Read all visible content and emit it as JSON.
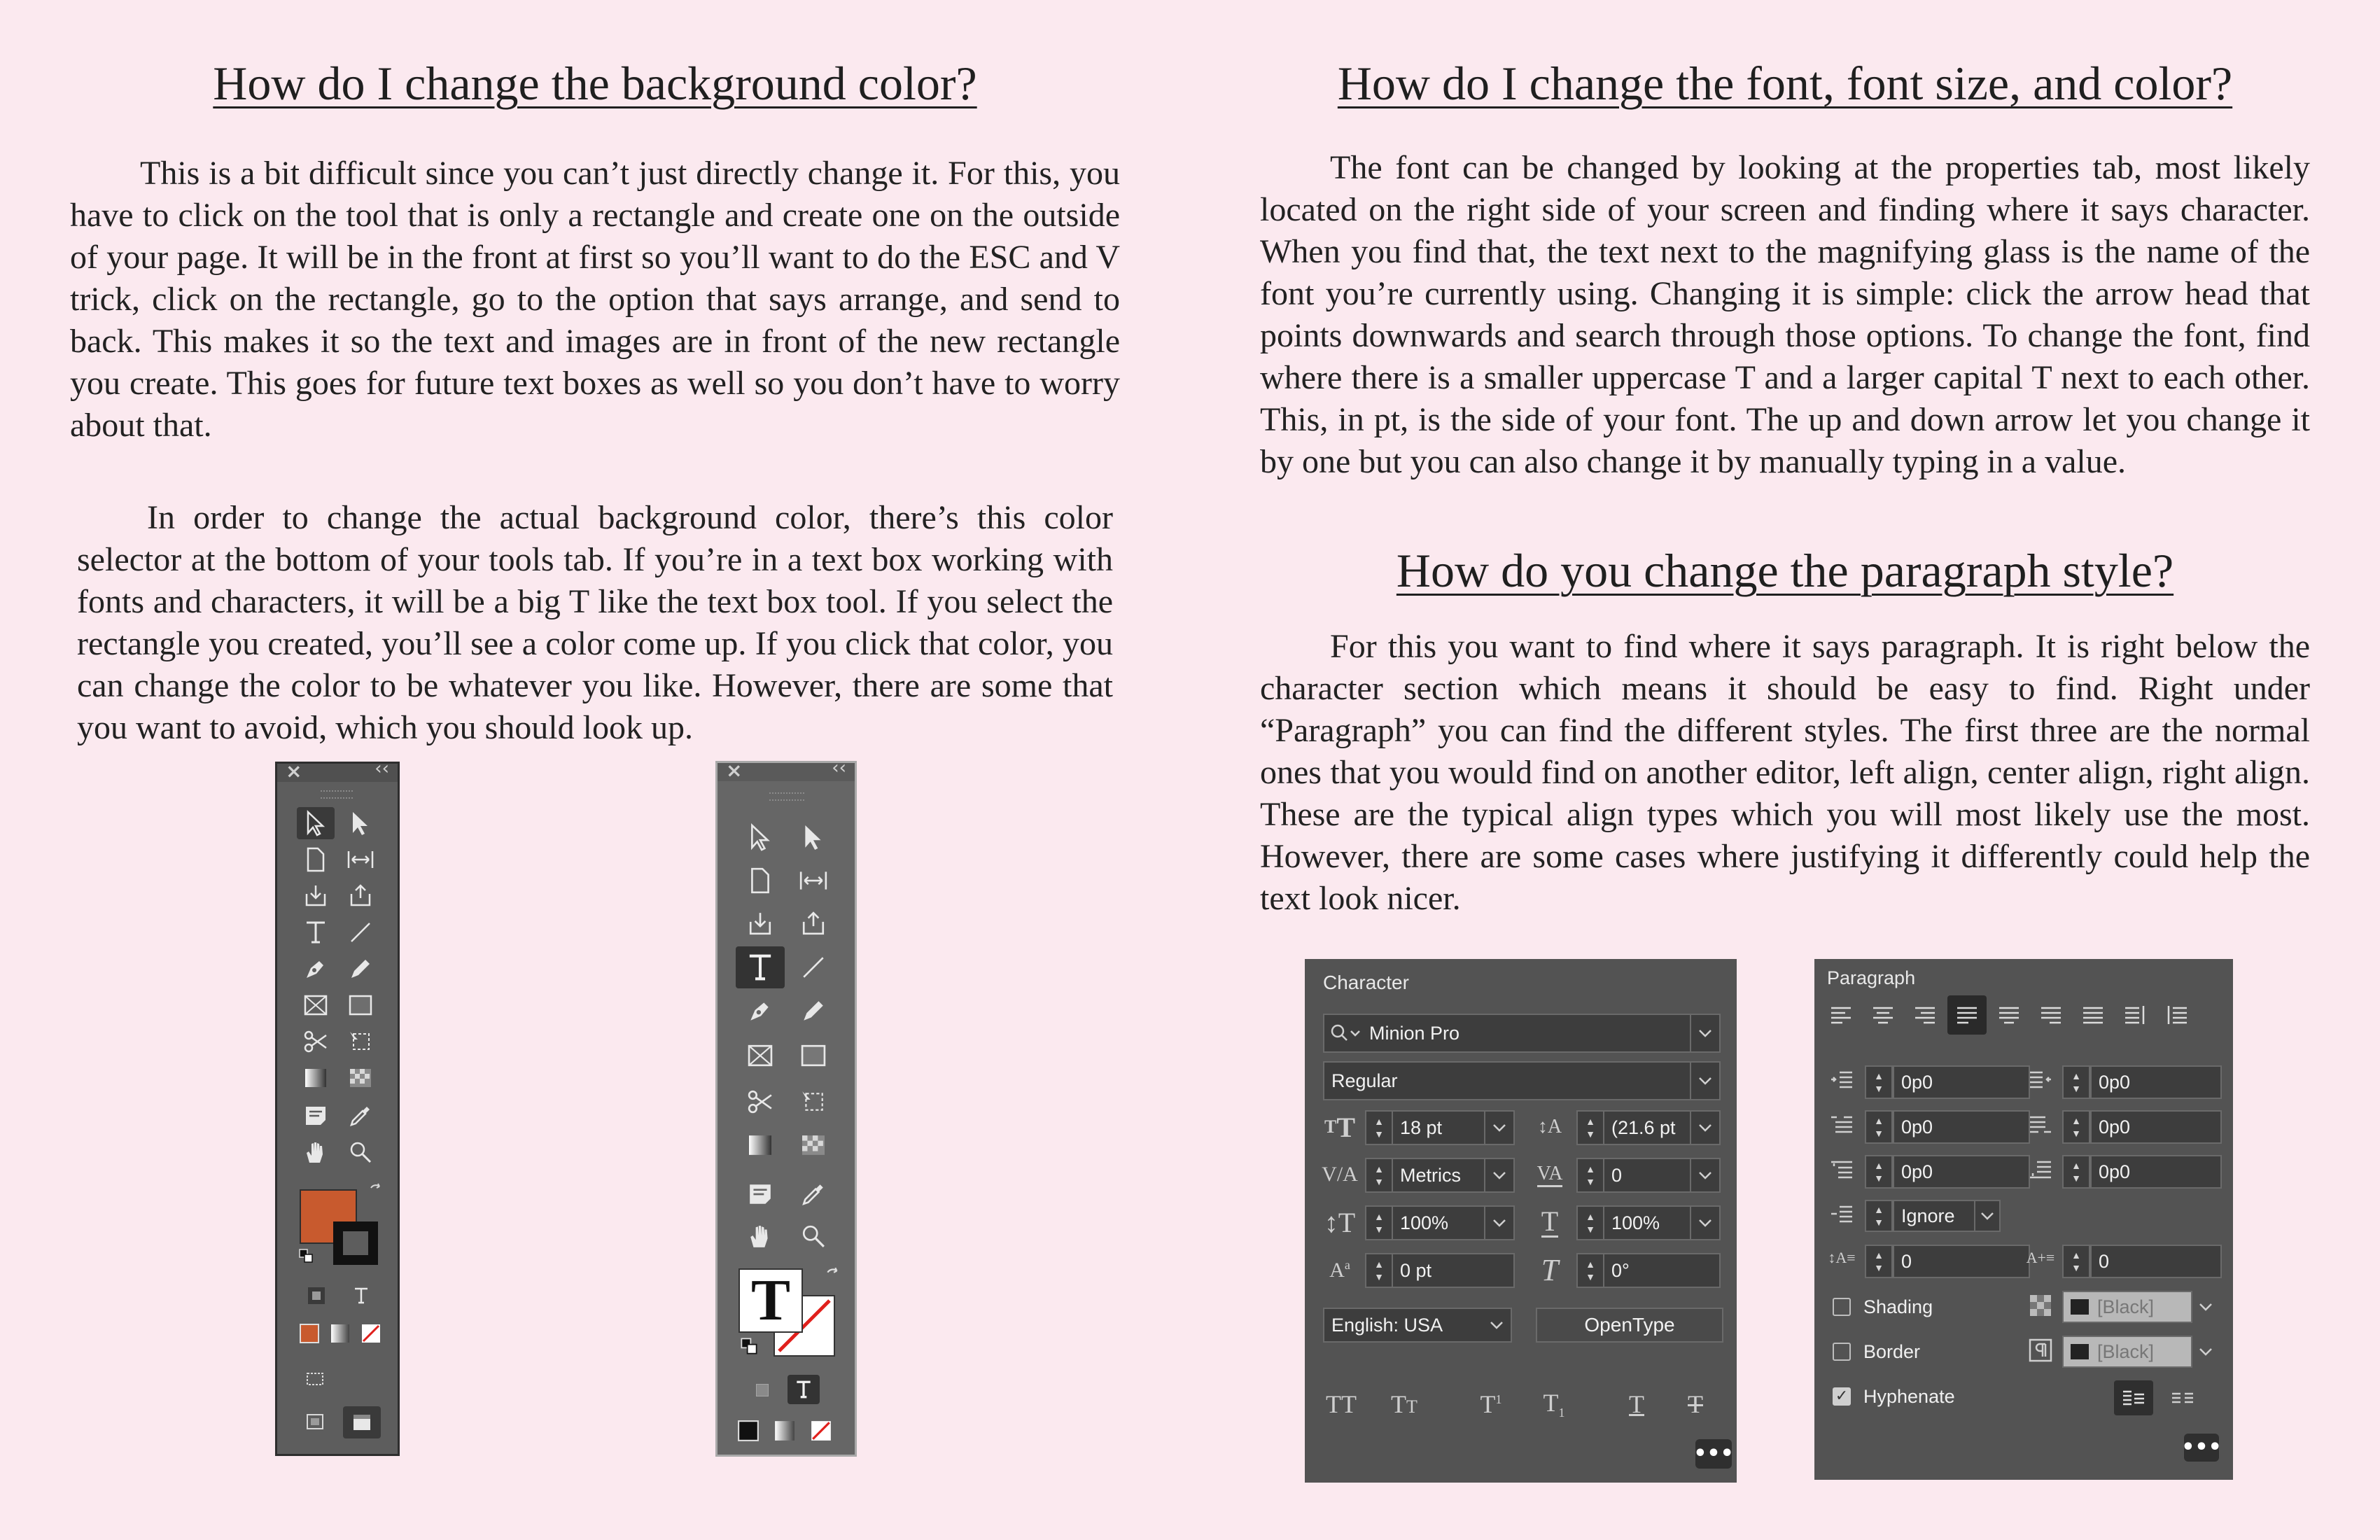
{
  "left": {
    "heading": "How do I change the background color?",
    "para1": "This is a bit difficult since you can’t just directly change it. For this, you have to click on the tool that is only a rectangle and create one on the outside of your page. It will be in the front at first so you’ll want to do the ESC and V trick, click on the rectangle, go to the option that says arrange, and send to back. This makes it so the text and images are in front of the new rectangle you create. This goes for future text boxes as well so you don’t have to worry about that.",
    "para2": "In order to change the actual background color, there’s this color selector at the bottom of your tools tab. If you’re in a text box working with fonts and characters, it will be a big T like the text box tool. If you select the rectangle you created, you’ll see a color come up. If you click that color, you can change the color to be whatever you like. However, there are some that you want to avoid, which you should look up."
  },
  "right": {
    "heading1": "How do I change the font, font size, and color?",
    "para1": "The font can be changed by looking at the properties tab, most likely located on the right side of your screen and finding where it says character. When you find that, the text next to the magnifying glass is the name of the font you’re currently using. Changing it is simple: click the arrow head that points downwards and search through those options. To change the font, find where there is a smaller uppercase T and a larger capital T next to each other. This, in pt, is the side of your font. The up and down arrow let you change it by one but you can also change it by manually typing in a value.",
    "heading2": "How do you change the paragraph style?",
    "para2": "For this you want to find where it says paragraph. It is right below the character section which means it should be easy to find. Right under “Paragraph” you can find the different styles. The first three are the normal ones that you would find on another editor, left align, center align, right align. These are the typical align types which you will most likely use the most. However, there are some cases where justifying it differently could help the text look nicer."
  },
  "toolbox": {
    "close_glyph": "×",
    "collapse_glyph": "‹‹",
    "fill_color": "#c85a2e",
    "type_glyph": "T"
  },
  "character_panel": {
    "title": "Character",
    "font_family": "Minion Pro",
    "font_style": "Regular",
    "font_size": "18 pt",
    "leading": "(21.6 pt",
    "kerning": "Metrics",
    "tracking": "0",
    "vertical_scale": "100%",
    "horizontal_scale": "100%",
    "baseline_shift": "0 pt",
    "skew": "0°",
    "language": "English: USA",
    "opentype_label": "OpenType",
    "more_label": "•••"
  },
  "paragraph_panel": {
    "title": "Paragraph",
    "left_indent": "0p0",
    "right_indent": "0p0",
    "first_line_indent": "0p0",
    "last_line_indent": "0p0",
    "space_before": "0p0",
    "space_after": "0p0",
    "align_to_grid": "Ignore",
    "drop_cap_lines": "0",
    "drop_cap_chars": "0",
    "shading_label": "Shading",
    "shading_swatch": "[Black]",
    "border_label": "Border",
    "border_swatch": "[Black]",
    "hyphenate_label": "Hyphenate",
    "hyphenate_checkmark": "✓",
    "more_label": "•••"
  }
}
